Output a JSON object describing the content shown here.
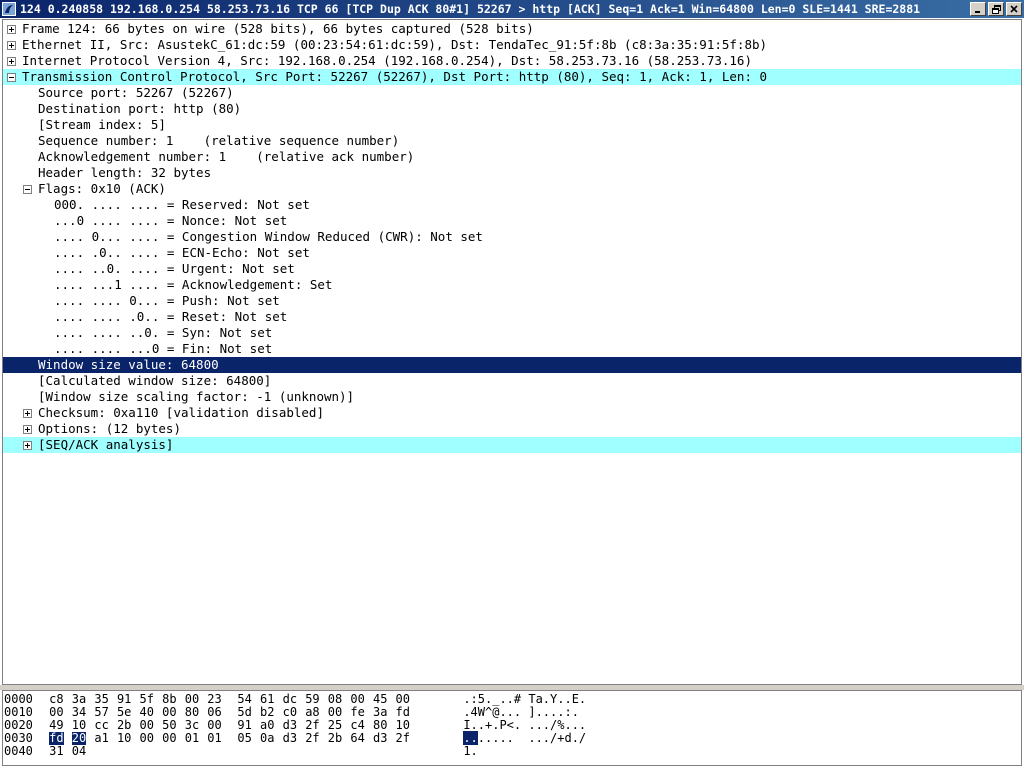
{
  "window": {
    "title": "124 0.240858 192.168.0.254 58.253.73.16 TCP 66 [TCP Dup ACK 80#1] 52267 > http [ACK] Seq=1 Ack=1 Win=64800 Len=0 SLE=1441 SRE=2881",
    "icon": "wireshark-fin-icon",
    "buttons": [
      "minimize-icon",
      "restore-icon",
      "close-icon"
    ]
  },
  "tree": {
    "rows": [
      {
        "text": "Frame 124: 66 bytes on wire (528 bits), 66 bytes captured (528 bits)",
        "toggle": "expand"
      },
      {
        "text": "Ethernet II, Src: AsustekC_61:dc:59 (00:23:54:61:dc:59), Dst: TendaTec_91:5f:8b (c8:3a:35:91:5f:8b)",
        "toggle": "expand"
      },
      {
        "text": "Internet Protocol Version 4, Src: 192.168.0.254 (192.168.0.254), Dst: 58.253.73.16 (58.253.73.16)",
        "toggle": "expand"
      },
      {
        "text": "Transmission Control Protocol, Src Port: 52267 (52267), Dst Port: http (80), Seq: 1, Ack: 1, Len: 0",
        "toggle": "collapse",
        "highlight": "cyan"
      },
      {
        "text": "Source port: 52267 (52267)"
      },
      {
        "text": "Destination port: http (80)"
      },
      {
        "text": "[Stream index: 5]"
      },
      {
        "text": "Sequence number: 1    (relative sequence number)"
      },
      {
        "text": "Acknowledgement number: 1    (relative ack number)"
      },
      {
        "text": "Header length: 32 bytes"
      },
      {
        "text": "Flags: 0x10 (ACK)",
        "toggle": "collapse"
      },
      {
        "text": "000. .... .... = Reserved: Not set"
      },
      {
        "text": "...0 .... .... = Nonce: Not set"
      },
      {
        "text": ".... 0... .... = Congestion Window Reduced (CWR): Not set"
      },
      {
        "text": ".... .0.. .... = ECN-Echo: Not set"
      },
      {
        "text": ".... ..0. .... = Urgent: Not set"
      },
      {
        "text": ".... ...1 .... = Acknowledgement: Set"
      },
      {
        "text": ".... .... 0... = Push: Not set"
      },
      {
        "text": ".... .... .0.. = Reset: Not set"
      },
      {
        "text": ".... .... ..0. = Syn: Not set"
      },
      {
        "text": ".... .... ...0 = Fin: Not set"
      },
      {
        "text": "Window size value: 64800",
        "highlight": "selected"
      },
      {
        "text": "[Calculated window size: 64800]"
      },
      {
        "text": "[Window size scaling factor: -1 (unknown)]"
      },
      {
        "text": "Checksum: 0xa110 [validation disabled]",
        "toggle": "expand"
      },
      {
        "text": "Options: (12 bytes)",
        "toggle": "expand"
      },
      {
        "text": "[SEQ/ACK analysis]",
        "toggle": "expand",
        "highlight": "cyan"
      }
    ]
  },
  "hex": {
    "rows": [
      {
        "offset": "0000",
        "bytes": [
          "c8",
          "3a",
          "35",
          "91",
          "5f",
          "8b",
          "00",
          "23",
          "54",
          "61",
          "dc",
          "59",
          "08",
          "00",
          "45",
          "00"
        ],
        "ascii": ".:5._..# Ta.Y..E."
      },
      {
        "offset": "0010",
        "bytes": [
          "00",
          "34",
          "57",
          "5e",
          "40",
          "00",
          "80",
          "06",
          "5d",
          "b2",
          "c0",
          "a8",
          "00",
          "fe",
          "3a",
          "fd"
        ],
        "ascii": ".4W^@... ]....:."
      },
      {
        "offset": "0020",
        "bytes": [
          "49",
          "10",
          "cc",
          "2b",
          "00",
          "50",
          "3c",
          "00",
          "91",
          "a0",
          "d3",
          "2f",
          "25",
          "c4",
          "80",
          "10"
        ],
        "ascii": "I..+.P<. .../%..."
      },
      {
        "offset": "0030",
        "bytes": [
          "fd",
          "20",
          "a1",
          "10",
          "00",
          "00",
          "01",
          "01",
          "05",
          "0a",
          "d3",
          "2f",
          "2b",
          "64",
          "d3",
          "2f"
        ],
        "ascii": ".......  .../+d./",
        "selected": [
          0,
          1
        ]
      },
      {
        "offset": "0040",
        "bytes": [
          "31",
          "04"
        ],
        "ascii": "1."
      }
    ]
  }
}
